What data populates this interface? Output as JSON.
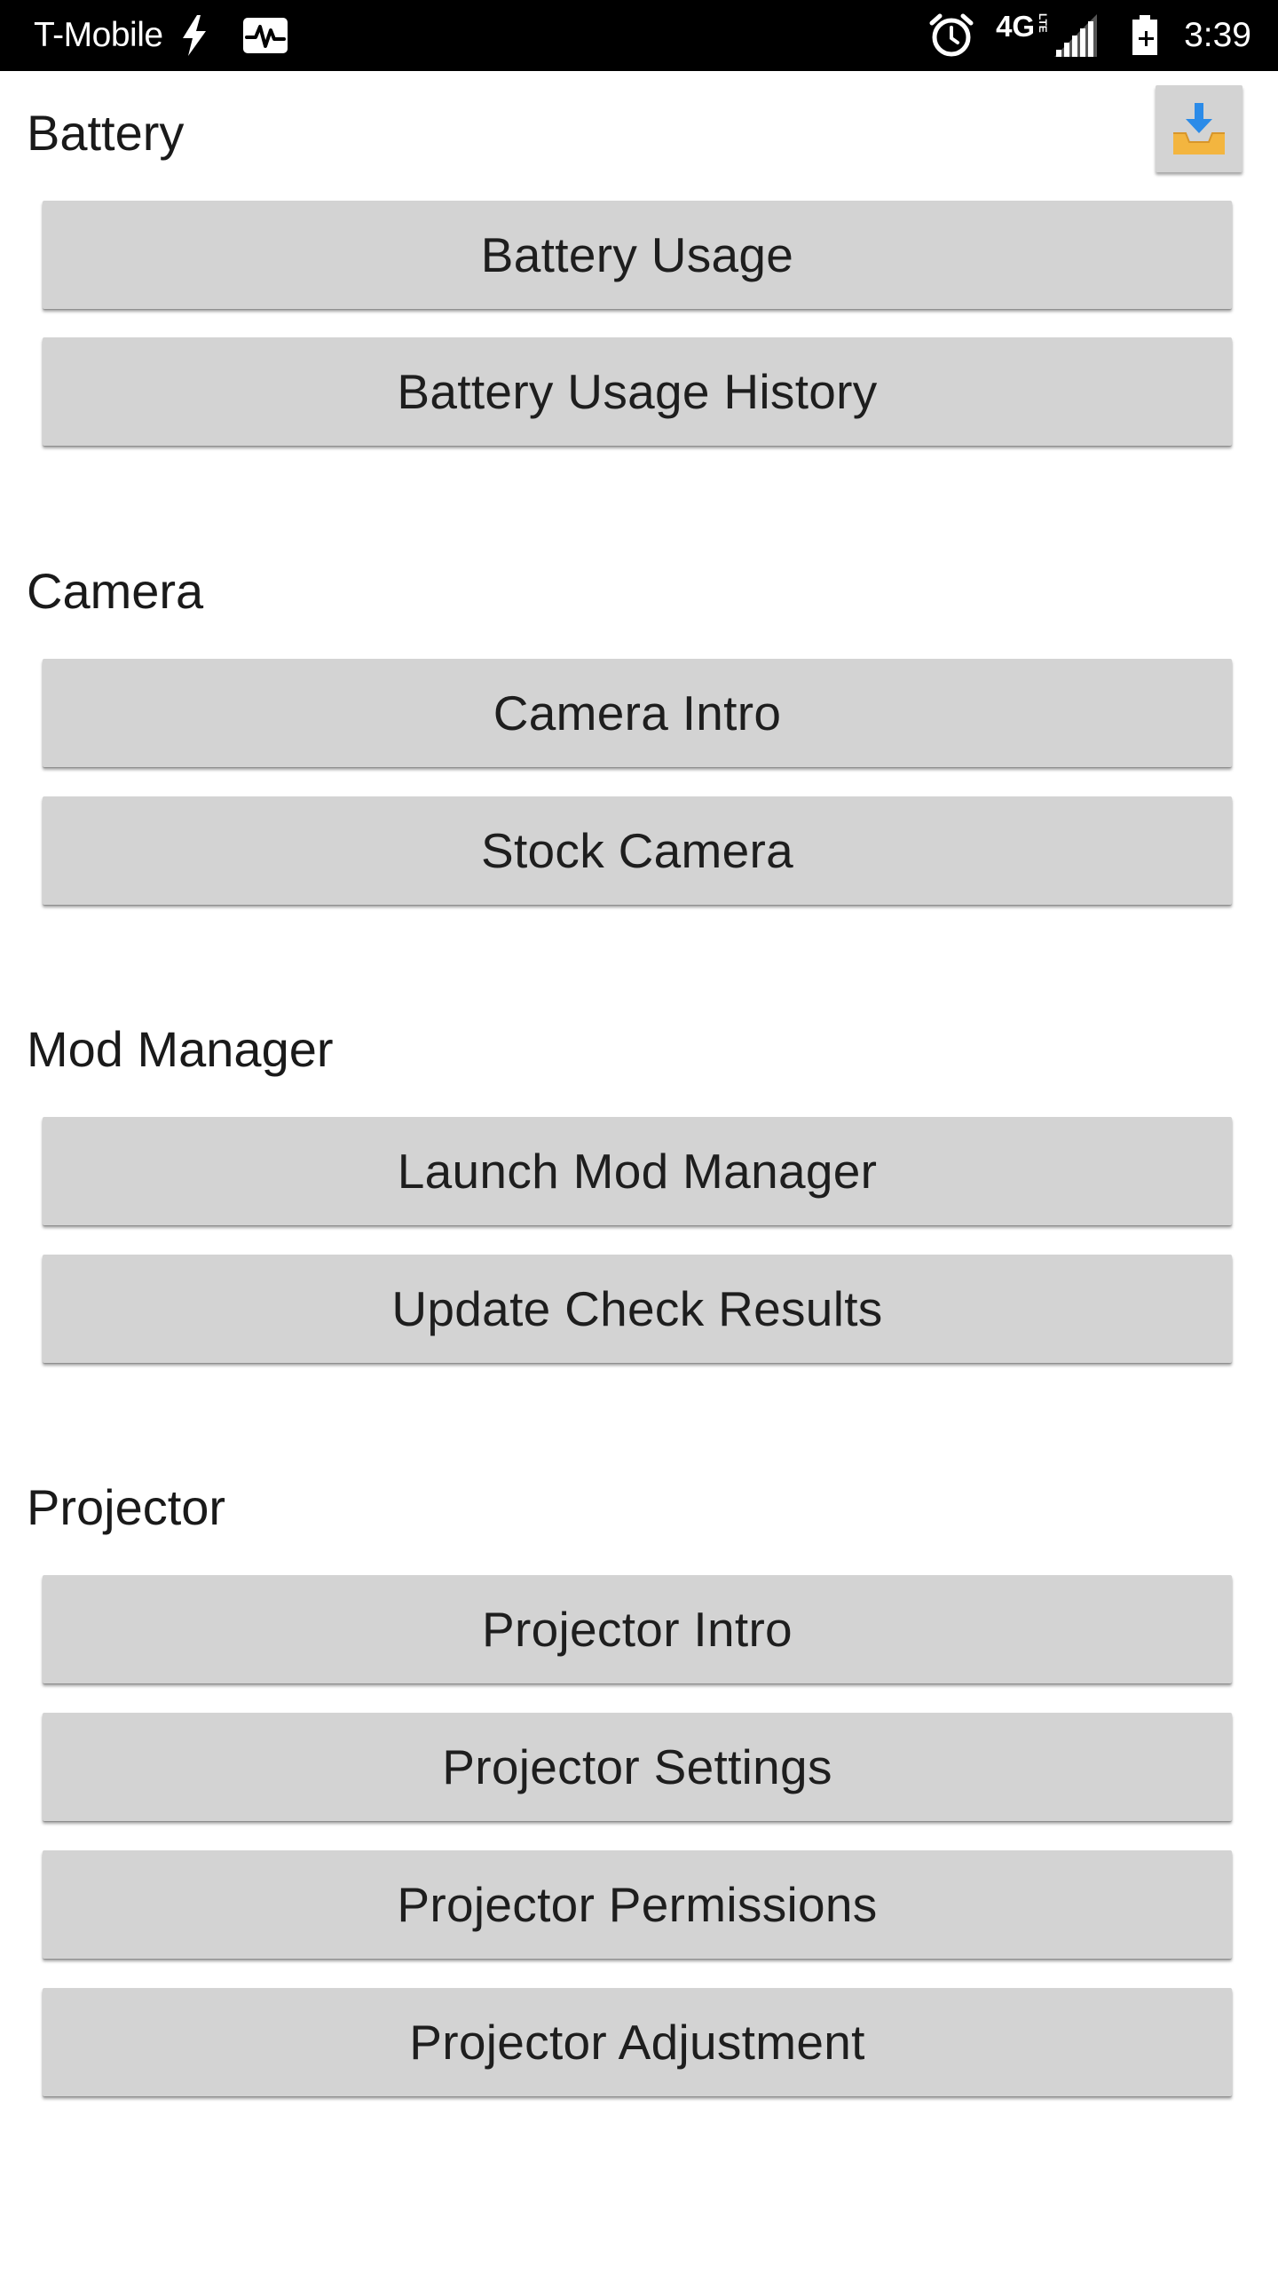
{
  "status_bar": {
    "carrier": "T-Mobile",
    "network_type": "4G",
    "network_sub": "LTE",
    "time": "3:39",
    "icons": [
      "charging-bolt-icon",
      "activity-pulse-icon",
      "alarm-clock-icon",
      "signal-strength-icon",
      "battery-charging-icon"
    ]
  },
  "toolbar": {
    "download_icon": "download-tray-icon",
    "download_colors": {
      "arrow": "#2b8be8",
      "tray": "#f3b53f"
    }
  },
  "sections": [
    {
      "title": "Battery",
      "buttons": [
        "Battery Usage",
        "Battery Usage History"
      ]
    },
    {
      "title": "Camera",
      "buttons": [
        "Camera Intro",
        "Stock Camera"
      ]
    },
    {
      "title": "Mod Manager",
      "buttons": [
        "Launch Mod Manager",
        "Update Check Results"
      ]
    },
    {
      "title": "Projector",
      "buttons": [
        "Projector Intro",
        "Projector Settings",
        "Projector Permissions",
        "Projector Adjustment"
      ]
    }
  ],
  "colors": {
    "status_bar_bg": "#000000",
    "button_bg": "#d3d3d3",
    "page_bg": "#ffffff"
  }
}
